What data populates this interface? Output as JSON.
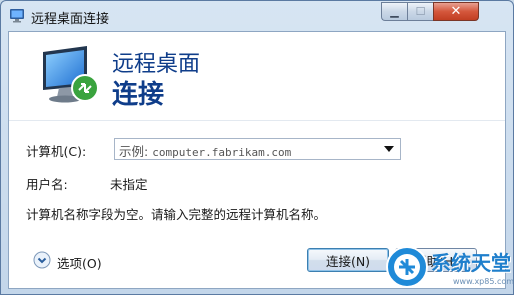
{
  "window": {
    "title": "远程桌面连接",
    "controls": {
      "minimize_glyph": "▁",
      "maximize_glyph": "☐",
      "close_glyph": "✕"
    }
  },
  "banner": {
    "line1": "远程桌面",
    "line2": "连接"
  },
  "form": {
    "computer_label": "计算机(C):",
    "computer_prefix": "示例:",
    "computer_host": "computer.fabrikam.com",
    "username_label": "用户名:",
    "username_value": "未指定",
    "message": "计算机名称字段为空。请输入完整的远程计算机名称。"
  },
  "footer": {
    "options_label": "选项(O)",
    "connect_button": "连接(N)",
    "help_button": "帮助(H)"
  },
  "watermark": {
    "text": "系统天堂",
    "url": "www.xp85.com"
  },
  "icons": {
    "title": "remote-desktop-icon",
    "banner": "monitor-remote-icon",
    "options": "chevron-down-circle-icon",
    "combo": "dropdown-arrow-icon",
    "watermark": "globe-logo-icon"
  },
  "colors": {
    "heading": "#0f3d8a",
    "close_button": "#c13e22",
    "frame": "#c3d6ea"
  }
}
